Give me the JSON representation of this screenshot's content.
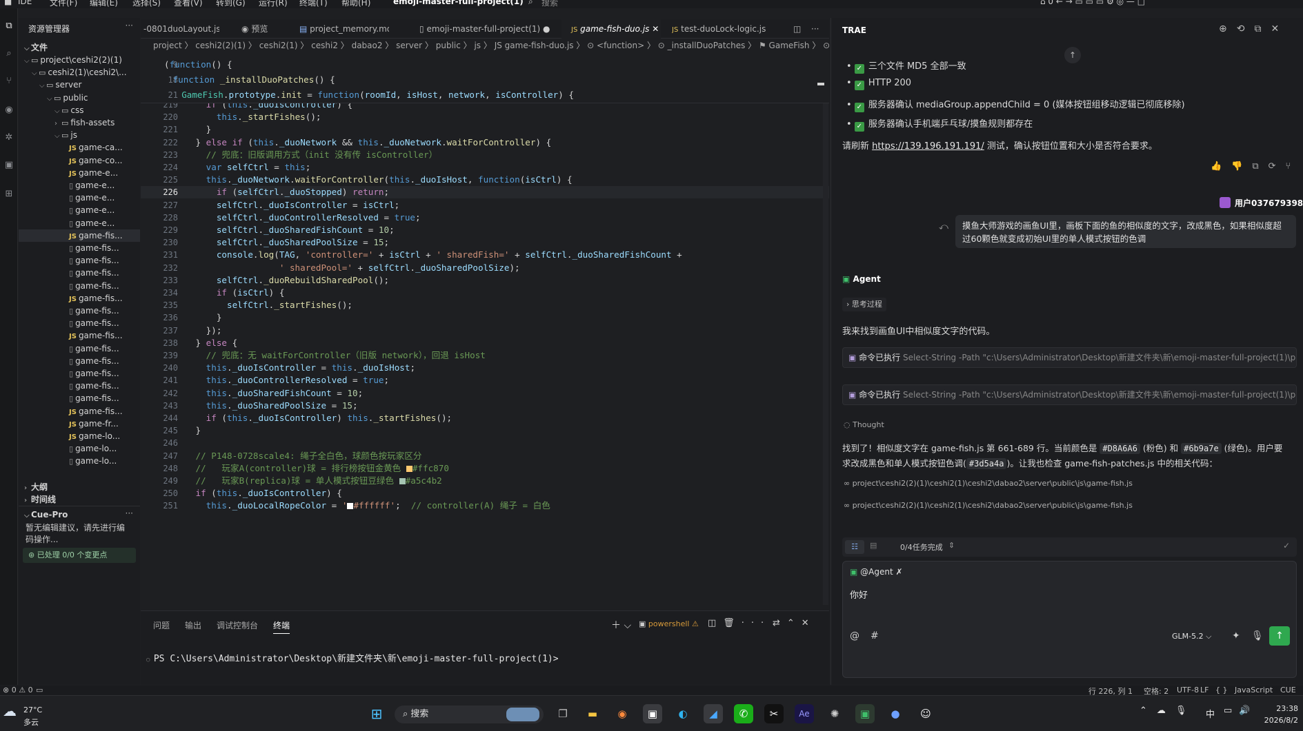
{
  "menubar": {
    "items": [
      "IDE",
      "文件(F)",
      "编辑(E)",
      "选择(S)",
      "查看(V)",
      "转到(G)",
      "运行(R)",
      "终端(T)",
      "帮助(H)"
    ],
    "project": "emoji-master-full-project(1)",
    "search": "搜索"
  },
  "explorer": {
    "title": "资源管理器",
    "section": "文件",
    "tree": [
      {
        "label": "project\\ceshi2(2)(1)",
        "indent": 0,
        "kind": "folder",
        "open": true
      },
      {
        "label": "ceshi2(1)\\ceshi2\\...",
        "indent": 1,
        "kind": "folder",
        "open": true
      },
      {
        "label": "server",
        "indent": 2,
        "kind": "folder",
        "open": true
      },
      {
        "label": "public",
        "indent": 3,
        "kind": "folder",
        "open": true
      },
      {
        "label": "css",
        "indent": 4,
        "kind": "folder",
        "open": true
      },
      {
        "label": "fish-assets",
        "indent": 4,
        "kind": "folder",
        "open": false
      },
      {
        "label": "js",
        "indent": 4,
        "kind": "folder",
        "open": true
      },
      {
        "label": "game-ca...",
        "indent": 5,
        "kind": "js"
      },
      {
        "label": "game-co...",
        "indent": 5,
        "kind": "js"
      },
      {
        "label": "game-e...",
        "indent": 5,
        "kind": "js"
      },
      {
        "label": "game-e...",
        "indent": 5,
        "kind": "file"
      },
      {
        "label": "game-e...",
        "indent": 5,
        "kind": "file"
      },
      {
        "label": "game-e...",
        "indent": 5,
        "kind": "file"
      },
      {
        "label": "game-e...",
        "indent": 5,
        "kind": "file"
      },
      {
        "label": "game-fis...",
        "indent": 5,
        "kind": "js",
        "selected": true
      },
      {
        "label": "game-fis...",
        "indent": 5,
        "kind": "file"
      },
      {
        "label": "game-fis...",
        "indent": 5,
        "kind": "file"
      },
      {
        "label": "game-fis...",
        "indent": 5,
        "kind": "file"
      },
      {
        "label": "game-fis...",
        "indent": 5,
        "kind": "file"
      },
      {
        "label": "game-fis...",
        "indent": 5,
        "kind": "js"
      },
      {
        "label": "game-fis...",
        "indent": 5,
        "kind": "file"
      },
      {
        "label": "game-fis...",
        "indent": 5,
        "kind": "file"
      },
      {
        "label": "game-fis...",
        "indent": 5,
        "kind": "js"
      },
      {
        "label": "game-fis...",
        "indent": 5,
        "kind": "file"
      },
      {
        "label": "game-fis...",
        "indent": 5,
        "kind": "file"
      },
      {
        "label": "game-fis...",
        "indent": 5,
        "kind": "file"
      },
      {
        "label": "game-fis...",
        "indent": 5,
        "kind": "file"
      },
      {
        "label": "game-fis...",
        "indent": 5,
        "kind": "file"
      },
      {
        "label": "game-fis...",
        "indent": 5,
        "kind": "js"
      },
      {
        "label": "game-fr...",
        "indent": 5,
        "kind": "js"
      },
      {
        "label": "game-lo...",
        "indent": 5,
        "kind": "js"
      },
      {
        "label": "game-lo...",
        "indent": 5,
        "kind": "file"
      },
      {
        "label": "game-lo...",
        "indent": 5,
        "kind": "file"
      }
    ],
    "outline": "大纲",
    "timeline": "时间线",
    "cue_title": "Cue-Pro",
    "cue_text": "暂无编辑建议，请先进行编码操作...",
    "cue_status": "已处理 0/0 个变更点"
  },
  "tabs": [
    {
      "label": "-0801duoLayout.js",
      "icon": ""
    },
    {
      "label": "预览",
      "icon": "◉"
    },
    {
      "label": "project_memory.md",
      "icon": "▤"
    },
    {
      "label": "emoji-master-full-project(1)",
      "icon": "▯"
    },
    {
      "label": "game-fish-duo.js",
      "icon": "JS",
      "active": true
    },
    {
      "label": "test-duoLock-logic.js",
      "icon": "JS"
    }
  ],
  "breadcrumb": "project 〉 ceshi2(2)(1) 〉 ceshi2(1) 〉 ceshi2 〉 dabao2 〉 server 〉 public 〉 js 〉 JS game-fish-duo.js 〉 ⊙ <function> 〉 ⊙ _installDuoPatches 〉 ⚑ GameFish 〉 ⊙ init 〉 ⊙",
  "sticky": [
    {
      "ln": "9",
      "html": "<span class='pn'>(</span><span class='kw'>function</span><span class='pn'>() {</span>",
      "indent": 0
    },
    {
      "ln": "18",
      "html": "<span class='kw'>function</span> <span class='fn'>_installDuoPatches</span><span class='pn'>() {</span>",
      "indent": 1
    },
    {
      "ln": "21",
      "html": "<span class='tp'>GameFish</span>.<span class='id'>prototype</span>.<span class='fn'>init</span> = <span class='kw'>function</span>(<span class='id'>roomId</span>, <span class='id'>isHost</span>, <span class='id'>network</span>, <span class='id'>isController</span>) {",
      "indent": 2
    }
  ],
  "code": [
    {
      "ln": "219",
      "html": "        <span class='kw2'>if</span> (<span class='kw'>this</span>.<span class='id'>_duoIsController</span>) {"
    },
    {
      "ln": "220",
      "html": "          <span class='kw'>this</span>.<span class='fn'>_startFishes</span>();"
    },
    {
      "ln": "221",
      "html": "        }"
    },
    {
      "ln": "222",
      "html": "      } <span class='kw2'>else if</span> (<span class='kw'>this</span>.<span class='id'>_duoNetwork</span> &amp;&amp; <span class='kw'>this</span>.<span class='id'>_duoNetwork</span>.<span class='fn'>waitForController</span>) {"
    },
    {
      "ln": "223",
      "html": "        <span class='cm'>// 兜底：旧版调用方式（init 没有传 isController）</span>"
    },
    {
      "ln": "224",
      "html": "        <span class='kw'>var</span> <span class='id'>selfCtrl</span> = <span class='kw'>this</span>;"
    },
    {
      "ln": "225",
      "html": "        <span class='kw'>this</span>.<span class='id'>_duoNetwork</span>.<span class='fn'>waitForController</span>(<span class='kw'>this</span>.<span class='id'>_duoIsHost</span>, <span class='kw'>function</span>(<span class='id'>isCtrl</span>) {"
    },
    {
      "ln": "226",
      "html": "          <span class='kw2'>if</span> (<span class='id'>selfCtrl</span>.<span class='id'>_duoStopped</span>) <span class='kw2'>return</span>;",
      "current": true
    },
    {
      "ln": "227",
      "html": "          <span class='id'>selfCtrl</span>.<span class='id'>_duoIsController</span> = <span class='id'>isCtrl</span>;"
    },
    {
      "ln": "228",
      "html": "          <span class='id'>selfCtrl</span>.<span class='id'>_duoControllerResolved</span> = <span class='kw'>true</span>;"
    },
    {
      "ln": "229",
      "html": "          <span class='id'>selfCtrl</span>.<span class='id'>_duoSharedFishCount</span> = <span class='num'>10</span>;"
    },
    {
      "ln": "230",
      "html": "          <span class='id'>selfCtrl</span>.<span class='id'>_duoSharedPoolSize</span> = <span class='num'>15</span>;"
    },
    {
      "ln": "231",
      "html": "          <span class='id'>console</span>.<span class='fn'>log</span>(<span class='id'>TAG</span>, <span class='str'>'controller='</span> + <span class='id'>isCtrl</span> + <span class='str'>' sharedFish='</span> + <span class='id'>selfCtrl</span>.<span class='id'>_duoSharedFishCount</span> +"
    },
    {
      "ln": "232",
      "html": "                      <span class='str'>' sharedPool='</span> + <span class='id'>selfCtrl</span>.<span class='id'>_duoSharedPoolSize</span>);"
    },
    {
      "ln": "233",
      "html": "          <span class='id'>selfCtrl</span>.<span class='fn'>_duoRebuildSharedPool</span>();"
    },
    {
      "ln": "234",
      "html": "          <span class='kw2'>if</span> (<span class='id'>isCtrl</span>) {"
    },
    {
      "ln": "235",
      "html": "            <span class='id'>selfCtrl</span>.<span class='fn'>_startFishes</span>();"
    },
    {
      "ln": "236",
      "html": "          }"
    },
    {
      "ln": "237",
      "html": "        });"
    },
    {
      "ln": "238",
      "html": "      } <span class='kw2'>else</span> {"
    },
    {
      "ln": "239",
      "html": "        <span class='cm'>// 兜底：无 waitForController（旧版 network），回退 isHost</span>"
    },
    {
      "ln": "240",
      "html": "        <span class='kw'>this</span>.<span class='id'>_duoIsController</span> = <span class='kw'>this</span>.<span class='id'>_duoIsHost</span>;"
    },
    {
      "ln": "241",
      "html": "        <span class='kw'>this</span>.<span class='id'>_duoControllerResolved</span> = <span class='kw'>true</span>;"
    },
    {
      "ln": "242",
      "html": "        <span class='kw'>this</span>.<span class='id'>_duoSharedFishCount</span> = <span class='num'>10</span>;"
    },
    {
      "ln": "243",
      "html": "        <span class='kw'>this</span>.<span class='id'>_duoSharedPoolSize</span> = <span class='num'>15</span>;"
    },
    {
      "ln": "244",
      "html": "        <span class='kw2'>if</span> (<span class='kw'>this</span>.<span class='id'>_duoIsController</span>) <span class='kw'>this</span>.<span class='fn'>_startFishes</span>();"
    },
    {
      "ln": "245",
      "html": "      }"
    },
    {
      "ln": "246",
      "html": ""
    },
    {
      "ln": "247",
      "html": "      <span class='cm'>// P148-0728scale4: 绳子全白色，球颜色按玩家区分</span>"
    },
    {
      "ln": "248",
      "html": "      <span class='cm'>//   玩家A(controller)球 = 排行榜按钮金黄色 <span style='display:inline-block;width:9px;height:9px;background:#ffc870;vertical-align:-1px'></span>#ffc870</span>"
    },
    {
      "ln": "249",
      "html": "      <span class='cm'>//   玩家B(replica)球 = 单人模式按钮豆绿色 <span style='display:inline-block;width:9px;height:9px;background:#a5c4b2;vertical-align:-1px'></span>#a5c4b2</span>"
    },
    {
      "ln": "250",
      "html": "      <span class='kw2'>if</span> (<span class='kw'>this</span>.<span class='id'>_duoIsController</span>) {"
    },
    {
      "ln": "251",
      "html": "        <span class='kw'>this</span>.<span class='id'>_duoLocalRopeColor</span> = <span class='str'>'<span style=\"display:inline-block;width:9px;height:9px;background:#ffffff;vertical-align:-1px\"></span>#ffffff'</span>;  <span class='cm'>// controller(A) 绳子 = 白色</span>"
    }
  ],
  "panel": {
    "tabs": [
      "问题",
      "输出",
      "调试控制台",
      "终端"
    ],
    "active": "终端",
    "shell": "powershell",
    "prompt": "PS C:\\Users\\Administrator\\Desktop\\新建文件夹\\新\\emoji-master-full-project(1)>"
  },
  "chat": {
    "title": "TRAE",
    "checks": [
      "三个文件 MD5 全部一致",
      "HTTP 200",
      "服务器确认 mediaGroup.appendChild = 0 (媒体按钮组移动逻辑已彻底移除)",
      "服务器确认手机端乒乓球/摸鱼规则都存在"
    ],
    "refresh_prefix": "请刷新 ",
    "refresh_link": "https://139.196.191.191/",
    "refresh_suffix": " 测试，确认按钮位置和大小是否符合要求。",
    "user_name": "用户0376793986",
    "user_msg": "摸鱼大师游戏的画鱼UI里，画板下面的鱼的相似度的文字，改成黑色，如果相似度超过60颗色就变成初始UI里的单人模式按钮的色调",
    "agent": "Agent",
    "thinking": "思考过程",
    "agent_line": "我来找到画鱼UI中相似度文字的代码。",
    "cmd_label": "命令已执行",
    "cmd_text": "Select-String -Path \"c:\\Users\\Administrator\\Desktop\\新建文件夹\\新\\emoji-master-full-project(1)\\project...",
    "thought": "Thought",
    "found_1": "找到了！相似度文字在 game-fish.js 第 661-689 行。当前颜色是 ",
    "color1": "#D8A6A6",
    "found_2": " (粉色) 和 ",
    "color2": "#6b9a7e",
    "found_3": " (绿色)。用户要",
    "found_4": "求改成黑色和单人模式按钮色调(",
    "color3": "#3d5a4a",
    "found_5": ")。让我也检查 game-fish-patches.js 中的相关代码：",
    "ref": "project\\ceshi2(2)(1)\\ceshi2(1)\\ceshi2\\dabao2\\server\\public\\js\\game-fish.js",
    "tasks": "0/4任务完成",
    "input_chip": "@Agent",
    "input_value": "你好",
    "model": "GLM-5.2"
  },
  "status": {
    "left": "⊗ 0 ⚠ 0",
    "pos": "行 226, 列 1",
    "spaces": "空格: 2",
    "enc": "UTF-8",
    "eol": "LF",
    "lang": "JavaScript",
    "cue": "CUE"
  },
  "taskbar": {
    "temp": "27°C",
    "weather": "多云",
    "search": "搜索",
    "time": "23:38",
    "date": "2026/8/2",
    "ime": "中"
  }
}
